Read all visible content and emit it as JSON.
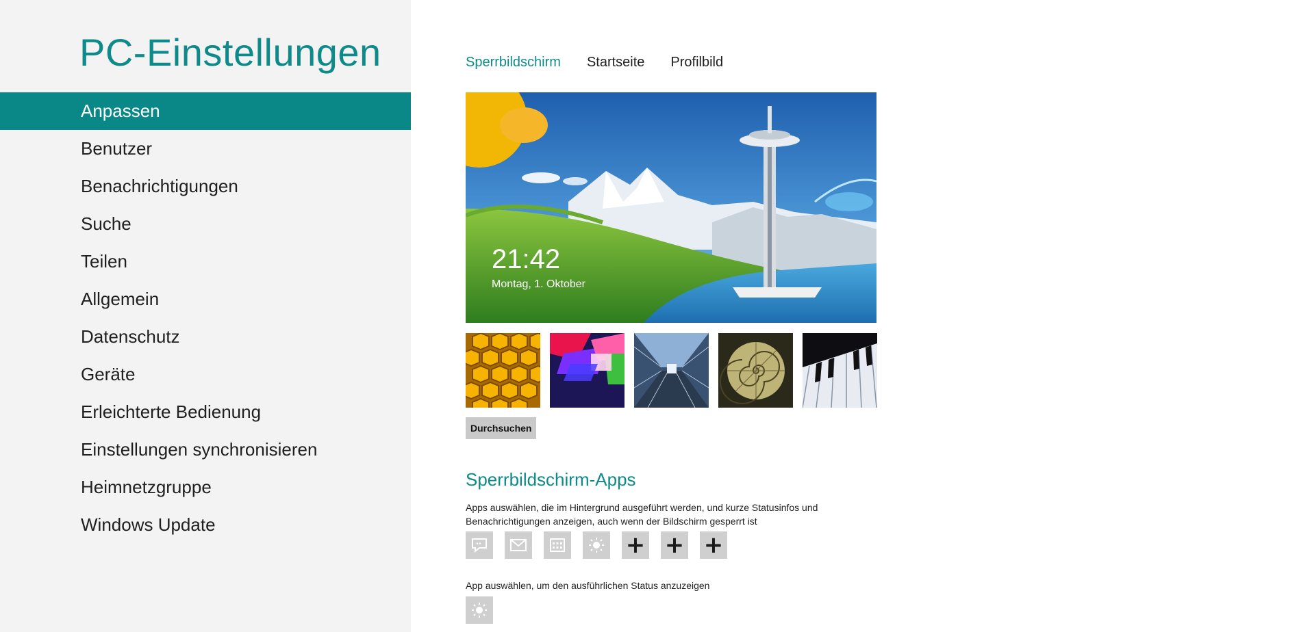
{
  "sidebar": {
    "title": "PC-Einstellungen",
    "items": [
      {
        "label": "Anpassen",
        "active": true
      },
      {
        "label": "Benutzer"
      },
      {
        "label": "Benachrichtigungen"
      },
      {
        "label": "Suche"
      },
      {
        "label": "Teilen"
      },
      {
        "label": "Allgemein"
      },
      {
        "label": "Datenschutz"
      },
      {
        "label": "Geräte"
      },
      {
        "label": "Erleichterte Bedienung"
      },
      {
        "label": "Einstellungen synchronisieren"
      },
      {
        "label": "Heimnetzgruppe"
      },
      {
        "label": "Windows Update"
      }
    ]
  },
  "tabs": [
    {
      "label": "Sperrbildschirm",
      "active": true
    },
    {
      "label": "Startseite"
    },
    {
      "label": "Profilbild"
    }
  ],
  "lock_preview": {
    "time": "21:42",
    "date": "Montag, 1. Oktober"
  },
  "thumbnails": [
    "honeycomb",
    "colorful-shapes",
    "train-tunnel",
    "nautilus-shell",
    "piano-keys"
  ],
  "browse_button": "Durchsuchen",
  "lock_apps": {
    "title": "Sperrbildschirm-Apps",
    "description": "Apps auswählen, die im Hintergrund ausgeführt werden, und kurze Statusinfos und Benachrichtigungen anzeigen, auch wenn der Bildschirm gesperrt ist",
    "slots": [
      "messaging-icon",
      "mail-icon",
      "calendar-icon",
      "weather-icon",
      "add-icon",
      "add-icon",
      "add-icon"
    ],
    "add_symbol": "+",
    "detail_label": "App auswählen, um den ausführlichen Status anzuzeigen",
    "detail_slot": "weather-icon"
  },
  "colors": {
    "accent": "#0f8a8a",
    "active_nav": "#0a8888",
    "sidebar_bg": "#f3f3f3",
    "slot_bg": "#cfcfcf"
  }
}
